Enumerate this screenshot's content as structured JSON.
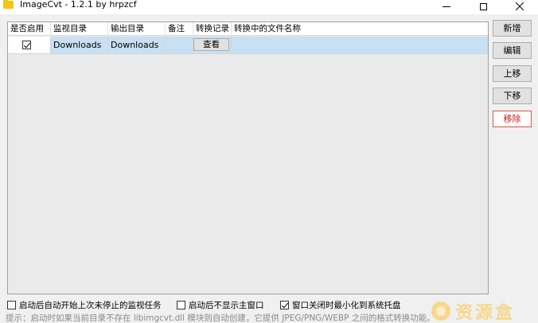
{
  "window": {
    "title": "ImageCvt - 1.2.1 by hrpzcf"
  },
  "table": {
    "columns": [
      "是否启用",
      "监视目录",
      "输出目录",
      "备注",
      "转换记录",
      "转换中的文件名称"
    ],
    "rows": [
      {
        "enabled": true,
        "watch_dir": "Downloads",
        "output_dir": "Downloads",
        "note": "",
        "record_button": "查看",
        "converting_file": ""
      }
    ]
  },
  "side_buttons": {
    "add": "新增",
    "edit": "编辑",
    "up": "上移",
    "down": "下移",
    "remove": "移除"
  },
  "options": {
    "auto_resume": {
      "label": "启动后自动开始上次未停止的监视任务",
      "checked": false
    },
    "hide_main": {
      "label": "启动后不显示主窗口",
      "checked": false
    },
    "minimize_tray": {
      "label": "窗口关闭时最小化到系统托盘",
      "checked": true
    }
  },
  "hint": "提示：启动时如果当前目录不存在 libimgcvt.dll 模块则自动创建，它提供 JPEG/PNG/WEBP 之间的格式转换功能。",
  "watermark": {
    "text": "资源盒"
  },
  "colors": {
    "selection": "#c8e0f4",
    "remove_border": "#e05050",
    "remove_text": "#c01a1a",
    "watermark": "#f6d88c"
  }
}
